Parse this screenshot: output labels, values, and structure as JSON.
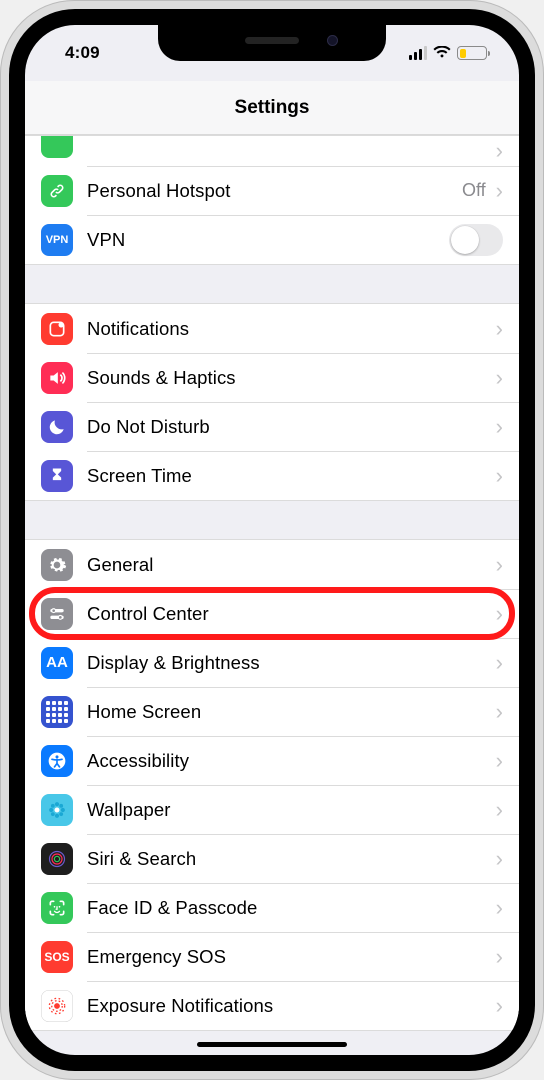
{
  "status": {
    "time": "4:09"
  },
  "nav": {
    "title": "Settings"
  },
  "highlight_row_key": "control-center",
  "groups": [
    {
      "rows": [
        {
          "key": "partial-top",
          "label": "",
          "icon": "blank-green",
          "icon_bg": "#34c85a",
          "accessory": "chevron",
          "cut": true
        },
        {
          "key": "personal-hotspot",
          "label": "Personal Hotspot",
          "icon": "chain",
          "icon_bg": "#34c85a",
          "accessory": "chevron",
          "detail": "Off"
        },
        {
          "key": "vpn",
          "label": "VPN",
          "icon": "vpn",
          "icon_bg": "#1e7cf1",
          "accessory": "switch",
          "switch_on": false
        }
      ]
    },
    {
      "rows": [
        {
          "key": "notifications",
          "label": "Notifications",
          "icon": "notif",
          "icon_bg": "#ff3b30",
          "accessory": "chevron"
        },
        {
          "key": "sounds-haptics",
          "label": "Sounds & Haptics",
          "icon": "sound",
          "icon_bg": "#ff2d55",
          "accessory": "chevron"
        },
        {
          "key": "do-not-disturb",
          "label": "Do Not Disturb",
          "icon": "moon",
          "icon_bg": "#5856d6",
          "accessory": "chevron"
        },
        {
          "key": "screen-time",
          "label": "Screen Time",
          "icon": "hourglass",
          "icon_bg": "#5856d6",
          "accessory": "chevron"
        }
      ]
    },
    {
      "rows": [
        {
          "key": "general",
          "label": "General",
          "icon": "gear",
          "icon_bg": "#8e8e93",
          "accessory": "chevron"
        },
        {
          "key": "control-center",
          "label": "Control Center",
          "icon": "sliders",
          "icon_bg": "#8e8e93",
          "accessory": "chevron"
        },
        {
          "key": "display-brightness",
          "label": "Display & Brightness",
          "icon": "aa",
          "icon_bg": "#0a7aff",
          "accessory": "chevron"
        },
        {
          "key": "home-screen",
          "label": "Home Screen",
          "icon": "grid",
          "icon_bg": "#3553cf",
          "accessory": "chevron"
        },
        {
          "key": "accessibility",
          "label": "Accessibility",
          "icon": "access",
          "icon_bg": "#0a7aff",
          "accessory": "chevron"
        },
        {
          "key": "wallpaper",
          "label": "Wallpaper",
          "icon": "flower",
          "icon_bg": "#48c7e8",
          "accessory": "chevron"
        },
        {
          "key": "siri-search",
          "label": "Siri & Search",
          "icon": "siri",
          "icon_bg": "#1e1e1e",
          "accessory": "chevron"
        },
        {
          "key": "face-id-passcode",
          "label": "Face ID & Passcode",
          "icon": "faceid",
          "icon_bg": "#34c85a",
          "accessory": "chevron"
        },
        {
          "key": "emergency-sos",
          "label": "Emergency SOS",
          "icon": "sos",
          "icon_bg": "#ff3b30",
          "accessory": "chevron"
        },
        {
          "key": "exposure-notifications",
          "label": "Exposure Notifications",
          "icon": "exposure",
          "icon_bg": "#ffffff",
          "accessory": "chevron",
          "icon_border": true
        }
      ]
    }
  ]
}
